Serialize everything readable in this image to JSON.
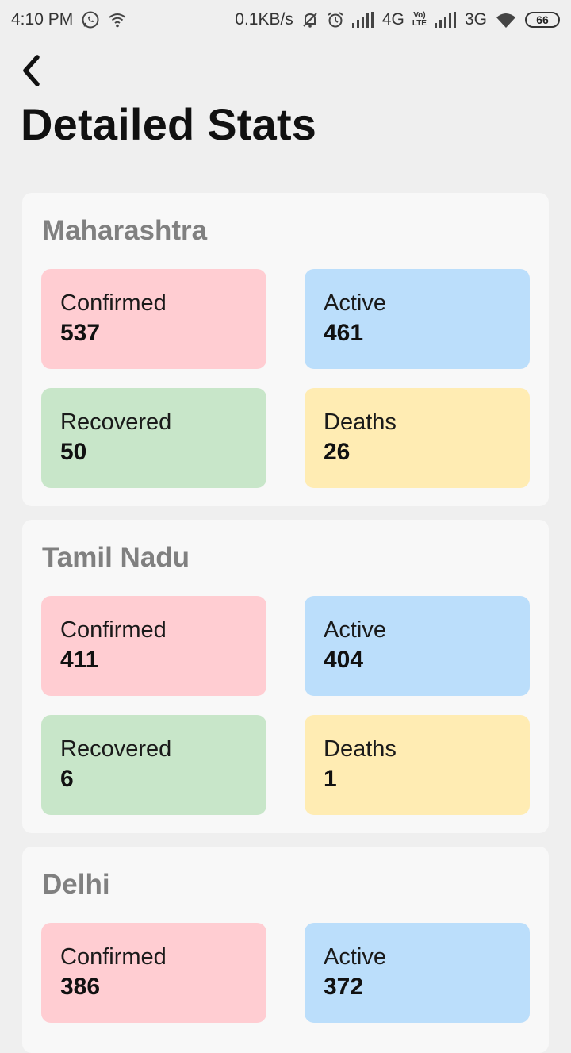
{
  "status_bar": {
    "time": "4:10 PM",
    "network_speed": "0.1KB/s",
    "network_4g": "4G",
    "volte_top": "Vo)",
    "volte_bottom": "LTE",
    "network_3g": "3G",
    "battery": "66"
  },
  "header": {
    "title": "Detailed Stats",
    "back_icon": "chevron-left-icon"
  },
  "colors": {
    "confirmed": "#ffcdd2",
    "active": "#bbdefb",
    "recovered": "#c8e6c9",
    "deaths": "#ffecb3"
  },
  "states": [
    {
      "name": "Maharashtra",
      "confirmed": {
        "label": "Confirmed",
        "value": "537"
      },
      "active": {
        "label": "Active",
        "value": "461"
      },
      "recovered": {
        "label": "Recovered",
        "value": "50"
      },
      "deaths": {
        "label": "Deaths",
        "value": "26"
      }
    },
    {
      "name": "Tamil Nadu",
      "confirmed": {
        "label": "Confirmed",
        "value": "411"
      },
      "active": {
        "label": "Active",
        "value": "404"
      },
      "recovered": {
        "label": "Recovered",
        "value": "6"
      },
      "deaths": {
        "label": "Deaths",
        "value": "1"
      }
    },
    {
      "name": "Delhi",
      "confirmed": {
        "label": "Confirmed",
        "value": "386"
      },
      "active": {
        "label": "Active",
        "value": "372"
      }
    }
  ]
}
